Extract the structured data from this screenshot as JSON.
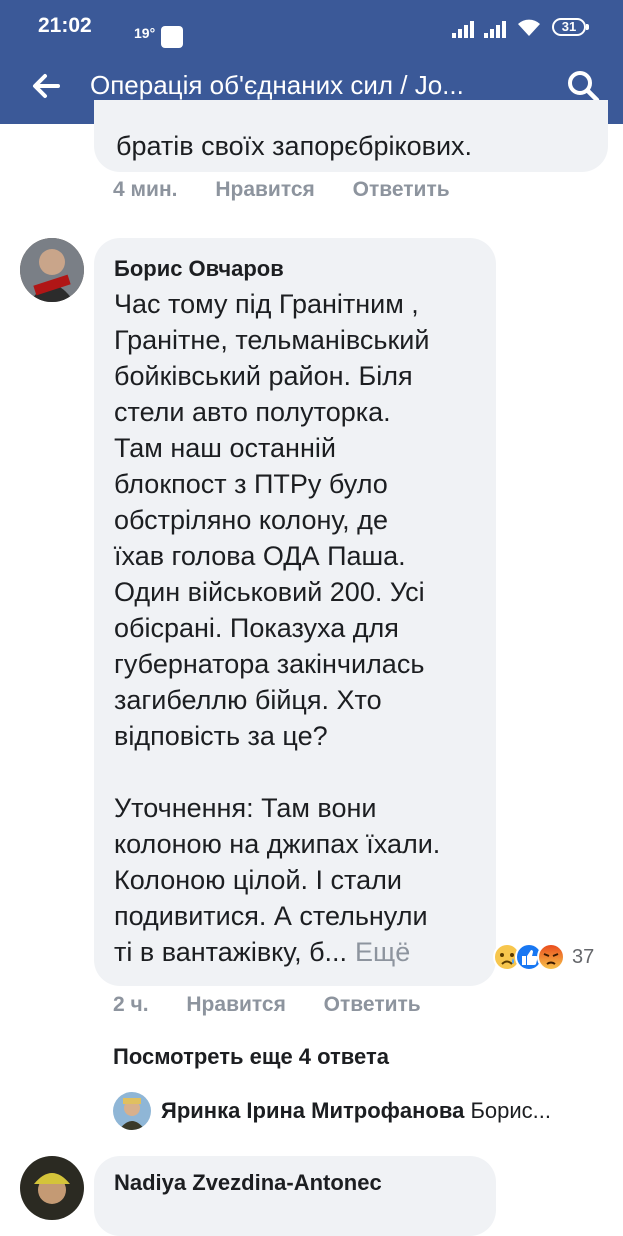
{
  "status_bar": {
    "time": "21:02",
    "temperature": "19°",
    "battery": "31"
  },
  "header": {
    "title": "Операція об'єднаних сил / Jo...",
    "back_icon": "arrow-left-icon",
    "search_icon": "search-icon"
  },
  "comments": [
    {
      "text": "братів своїх запорєбрікових.",
      "time": "4 мин.",
      "like": "Нравится",
      "reply": "Ответить"
    },
    {
      "author": "Борис Овчаров",
      "lines": [
        "Час тому під Гранітним ,",
        "Гранітне, тельманівський",
        "бойківський район. Біля",
        "стели авто полуторка.",
        "Там наш останній",
        "блокпост з ПТРу було",
        "обстріляно колону, де",
        "їхав голова ОДА Паша.",
        "Один військовий 200. Усі",
        "обісрані. Показуха для",
        "губернатора закінчилась",
        "загибеллю бійця. Хто",
        "відповість за це?",
        "",
        "Уточнення: Там вони",
        "колоною на джипах їхали.",
        "Колоною цілой. І стали",
        "подивитися. А стельнули",
        "ті в вантажівку, б..."
      ],
      "more": "Ещё",
      "reaction_count": "37",
      "time": "2 ч.",
      "like": "Нравится",
      "reply": "Ответить"
    }
  ],
  "view_more": "Посмотреть еще 4 ответа",
  "reply_preview": {
    "author": "Яринка Ірина Митрофанова",
    "text": "Борис..."
  },
  "next_comment": {
    "author": "Nadiya Zvezdina-Antonec"
  }
}
